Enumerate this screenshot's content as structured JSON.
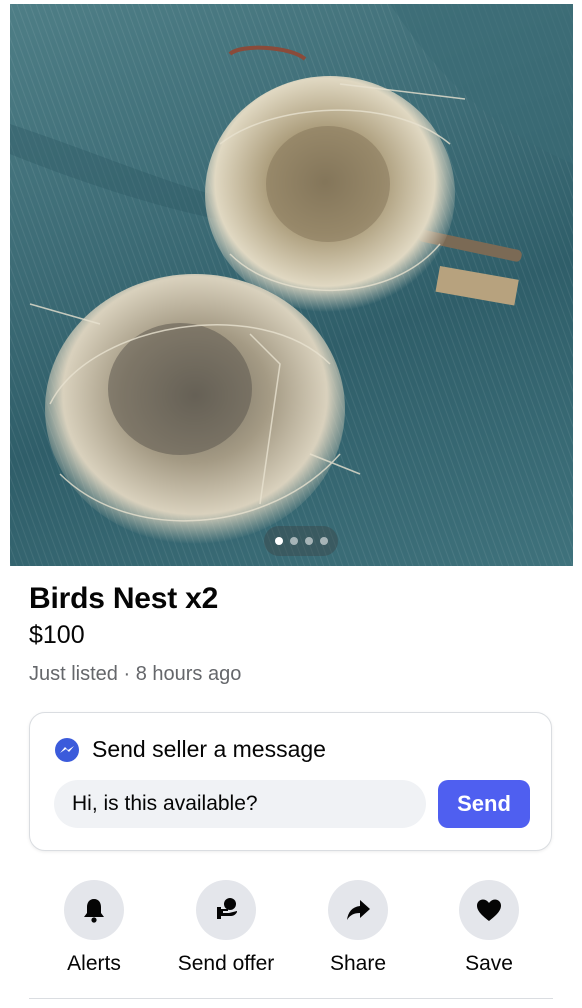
{
  "listing": {
    "photo_label": "Two bird nests on a teal cloth",
    "carousel": {
      "total": 4,
      "active_index": 0
    },
    "title": "Birds Nest x2",
    "price": "$100",
    "meta": "Just listed · 8 hours ago"
  },
  "message_card": {
    "heading": "Send seller a message",
    "input_value": "Hi, is this available?",
    "send_label": "Send"
  },
  "actions": [
    {
      "label": "Alerts",
      "icon": "bell-icon"
    },
    {
      "label": "Send offer",
      "icon": "offer-icon"
    },
    {
      "label": "Share",
      "icon": "share-icon"
    },
    {
      "label": "Save",
      "icon": "heart-icon"
    }
  ],
  "colors": {
    "accent": "#4f5ff0",
    "messenger": "#3b5bdb",
    "icon_bg": "#e4e6eb",
    "muted_text": "#65676b"
  }
}
